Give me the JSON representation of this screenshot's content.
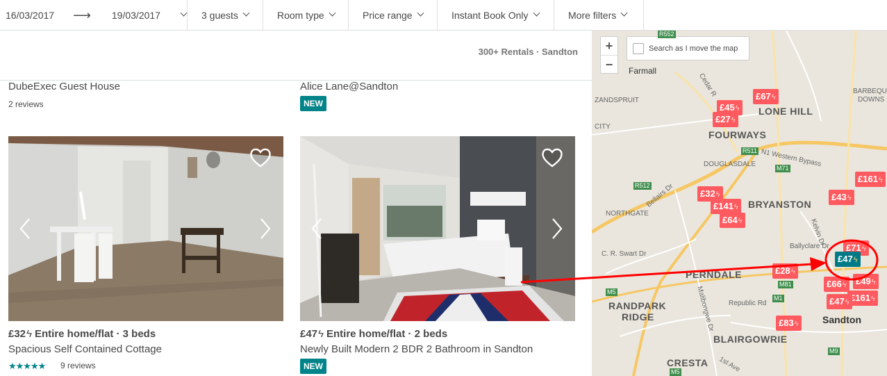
{
  "filters": {
    "check_in": "16/03/2017",
    "arrow": "⟶",
    "check_out": "19/03/2017",
    "guests": "3 guests",
    "room_type": "Room type",
    "price_range": "Price range",
    "instant_book": "Instant Book Only",
    "more_filters": "More filters"
  },
  "results": {
    "count_text": "300+ Rentals · Sandton"
  },
  "partial_listings": [
    {
      "title": "DubeExec Guest House",
      "sub": "2 reviews"
    },
    {
      "title": "Alice Lane@Sandton",
      "badge": "NEW"
    }
  ],
  "listings": [
    {
      "price": "£32",
      "bolt": "ϟ",
      "type": "Entire home/flat · 3 beds",
      "name": "Spacious Self Contained Cottage",
      "rating": 4.5,
      "stars": "★★★★★",
      "reviews": "9 reviews"
    },
    {
      "price": "£47",
      "bolt": "ϟ",
      "type": "Entire home/flat · 2 beds",
      "name": "Newly Built Modern 2 BDR 2 Bathroom in Sandton",
      "badge": "NEW"
    }
  ],
  "map": {
    "zoom_in": "+",
    "zoom_out": "−",
    "search_move": "Search as I move the map",
    "places": {
      "farmall": "Farmall",
      "lone_hill": "LONE HILL",
      "fourways": "FOURWAYS",
      "bryanston": "BRYANSTON",
      "perndale": "PERNDALE",
      "randpark": "RANDPARK",
      "ridge": "RIDGE",
      "blairgowrie": "BLAIRGOWRIE",
      "cresta": "CRESTA",
      "sandton": "Sandton",
      "northgate": "NORTHGATE",
      "douglasdale": "DOUGLASDALE",
      "zandspruit": "ZANDSPRUIT",
      "city": "CITY",
      "barbeque": "BARBEQUE",
      "downs": "DOWNS",
      "n1_bypass": "N1 Western Bypass",
      "cedar": "Cedar R",
      "republic": "Republic Rd",
      "ballyclare": "Ballyclare Dr",
      "cr_swart": "C. R. Swart Dr",
      "bellairs": "Bellairs Dr",
      "malibongwe": "Malibongwe Dr",
      "kelvin": "Kelvin Dr",
      "jan_smuts": "1st Ave"
    },
    "roads": {
      "r552": "R552",
      "r511": "R511",
      "r512": "R512",
      "m71": "M71",
      "m81": "M81",
      "m5": "M5",
      "m9": "M9",
      "m5b": "M5",
      "m1": "M1"
    },
    "pins": {
      "p1": "£67",
      "p2": "£45",
      "p3": "£27",
      "p4": "£32",
      "p5": "£141",
      "p6": "£64",
      "p7": "£161",
      "p8": "£43",
      "p9": "£71",
      "p10": "£47",
      "p11": "£28",
      "p12": "£66",
      "p13": "£49",
      "p14": "£161",
      "p15": "£47",
      "p16": "£83"
    },
    "pin_bolt": "ϟ"
  },
  "annotation": {
    "arrow_color": "#ff0000",
    "circle_color": "#ff0000"
  }
}
